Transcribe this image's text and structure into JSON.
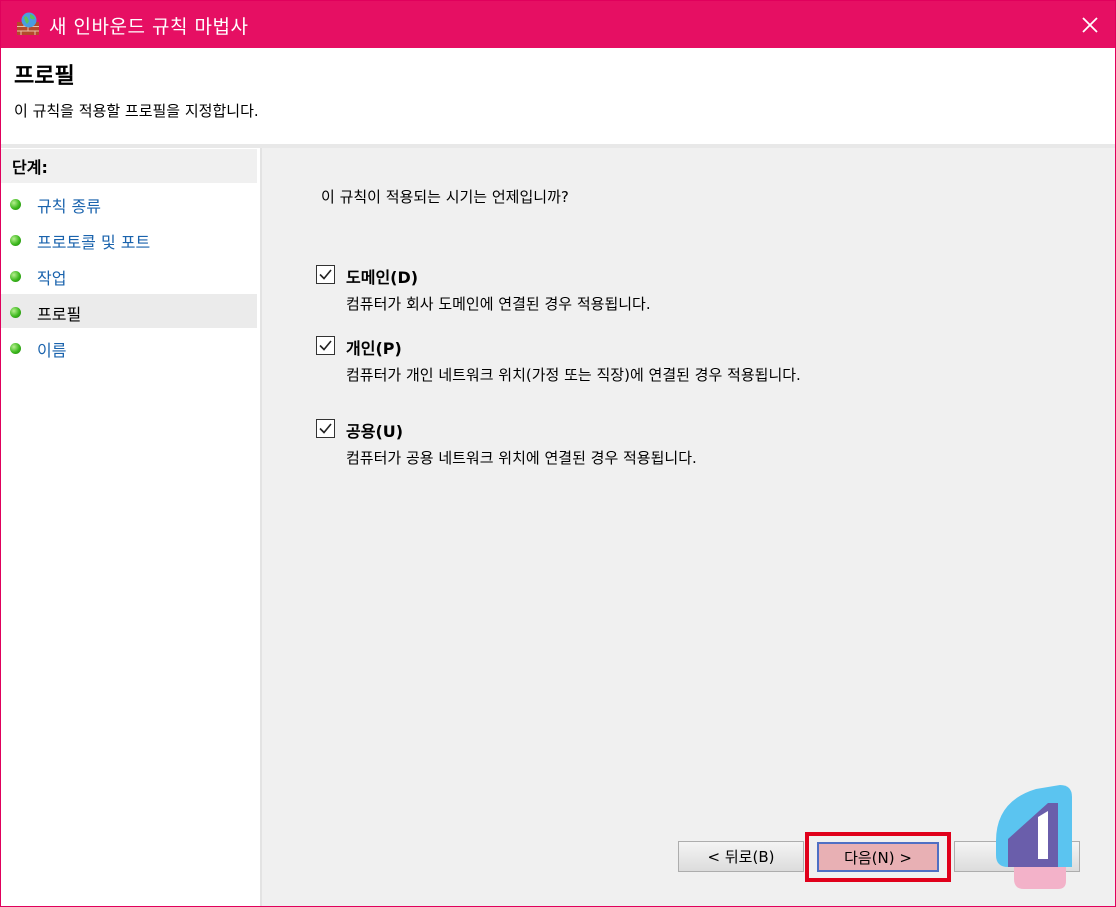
{
  "window": {
    "title": "새 인바운드 규칙 마법사",
    "close_symbol": "✕"
  },
  "header": {
    "title": "프로필",
    "description": "이 규칙을 적용할 프로필을 지정합니다."
  },
  "sidebar": {
    "steps_label": "단계:",
    "steps": [
      {
        "label": "규칙 종류"
      },
      {
        "label": "프로토콜 및 포트"
      },
      {
        "label": "작업"
      },
      {
        "label": "프로필"
      },
      {
        "label": "이름"
      }
    ],
    "active_step": "프로필"
  },
  "main": {
    "question": "이 규칙이 적용되는 시기는 언제입니까?",
    "options": [
      {
        "label": "도메인(D)",
        "checked": true,
        "description": "컴퓨터가 회사 도메인에 연결된 경우 적용됩니다."
      },
      {
        "label": "개인(P)",
        "checked": true,
        "description": "컴퓨터가 개인 네트워크 위치(가정 또는 직장)에 연결된 경우 적용됩니다."
      },
      {
        "label": "공용(U)",
        "checked": true,
        "description": "컴퓨터가 공용 네트워크 위치에 연결된 경우 적용됩니다."
      }
    ]
  },
  "buttons": {
    "back": "< 뒤로(B)",
    "next": "다음(N) >"
  },
  "colors": {
    "titlebar": "#e60f63",
    "highlight_box": "#e0001b",
    "step_link": "#1a63ad"
  }
}
